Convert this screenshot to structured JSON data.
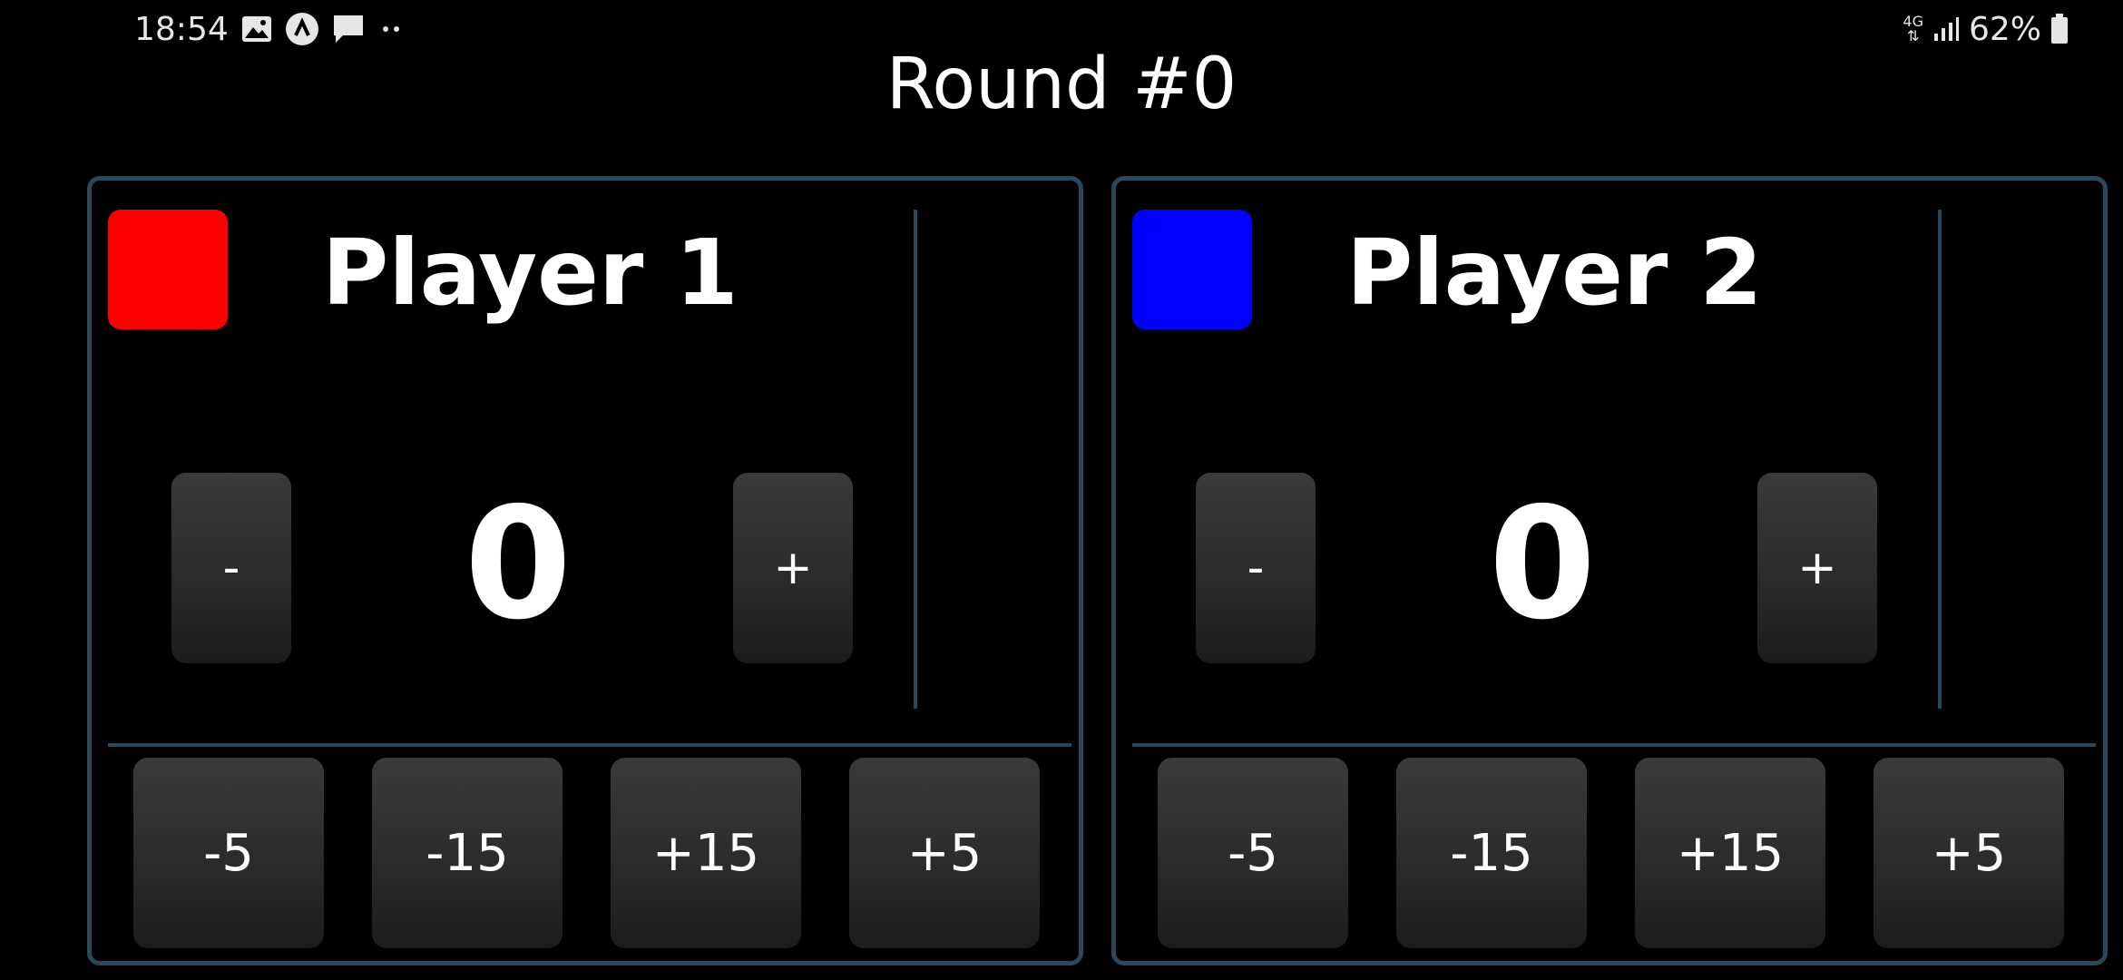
{
  "status_bar": {
    "time": "18:54",
    "notification_icons": [
      "gallery-icon",
      "app-notification-icon",
      "message-icon",
      "more-dots-icon"
    ],
    "network_label": "4G",
    "battery_percent": "62%"
  },
  "round": {
    "title": "Round #0"
  },
  "colors": {
    "panel_border": "#2c4756",
    "player1_color": "#ff0000",
    "player2_color": "#0000ff"
  },
  "players": [
    {
      "name": "Player 1",
      "score": "0",
      "minus_label": "-",
      "plus_label": "+",
      "steps": [
        "-5",
        "-15",
        "+15",
        "+5"
      ]
    },
    {
      "name": "Player 2",
      "score": "0",
      "minus_label": "-",
      "plus_label": "+",
      "steps": [
        "-5",
        "-15",
        "+15",
        "+5"
      ]
    }
  ]
}
